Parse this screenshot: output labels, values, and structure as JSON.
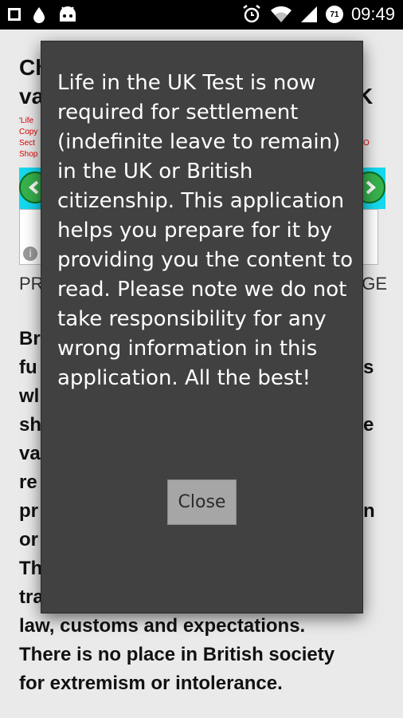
{
  "status_bar": {
    "time": "09:49",
    "badge": "71",
    "icons": [
      "square-icon",
      "drop-icon",
      "android-icon",
      "alarm-icon",
      "wifi-icon",
      "signal-icon",
      "battery-badge-icon"
    ]
  },
  "background": {
    "title_line1": "Ch",
    "title_line1_end": "K",
    "title_line2": "va",
    "red_text": [
      "'Life",
      "Copy",
      "Sect",
      "Shop"
    ],
    "red_text_end": "O",
    "nav_left": "PR",
    "nav_right": "GE",
    "body_visible_start": [
      "Br",
      "fu",
      "wl",
      "sh",
      "va",
      "re",
      "pr",
      "or",
      "Th",
      "tra"
    ],
    "body_visible_end": [
      "s",
      "",
      "e",
      "",
      "",
      "",
      "n",
      "",
      "",
      ""
    ],
    "body_line_partial": "law, customs and expectations.",
    "body_line_full1": "There is no place in British society",
    "body_line_full2": "for extremism or intolerance."
  },
  "dialog": {
    "message": "Life in the UK Test is now required for settlement (indefinite leave to remain) in the UK or British citizenship. This application helps you prepare for it by providing you the content to read. Please note we do not take responsibility for any wrong information in this application. All the best!",
    "close_label": "Close"
  },
  "colors": {
    "dialog_bg": "#414141",
    "banner_bg": "#15d9ef",
    "close_button_bg": "#a6a6a6"
  }
}
